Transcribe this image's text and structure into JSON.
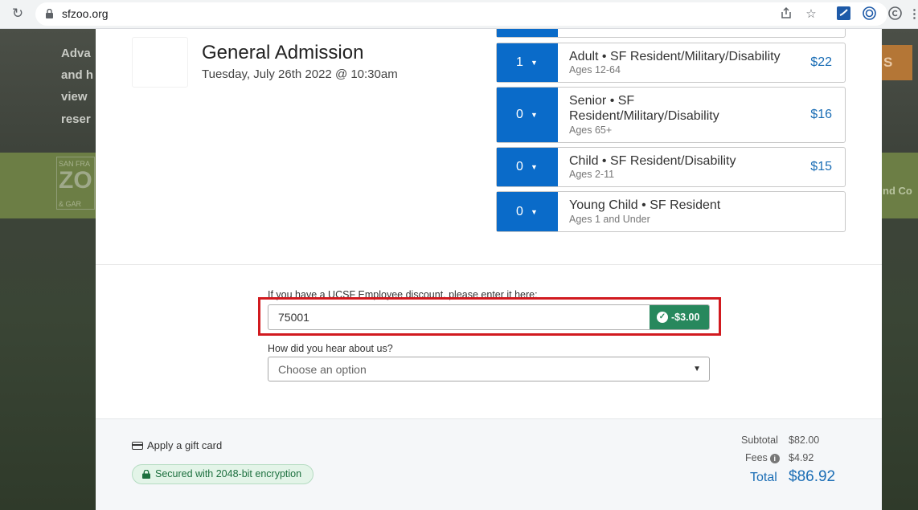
{
  "browser": {
    "url": "sfzoo.org"
  },
  "background": {
    "lines": [
      "Adva",
      "and h",
      "view",
      "reser"
    ],
    "side_text": "nd Co",
    "orange_text": "S",
    "logo_top": "SAN FRA",
    "logo_big": "ZO",
    "logo_bottom": "& GAR"
  },
  "event": {
    "title": "General Admission",
    "date": "Tuesday, July 26th 2022 @ 10:30am"
  },
  "tickets": [
    {
      "qty": "1",
      "name": "Adult • SF Resident/Military/Disability",
      "ages": "Ages 12-64",
      "price": "$22"
    },
    {
      "qty": "0",
      "name": "Senior • SF Resident/Military/Disability",
      "ages": "Ages 65+",
      "price": "$16"
    },
    {
      "qty": "0",
      "name": "Child • SF Resident/Disability",
      "ages": "Ages 2-11",
      "price": "$15"
    },
    {
      "qty": "0",
      "name": "Young Child • SF Resident",
      "ages": "Ages 1 and Under",
      "price": ""
    }
  ],
  "discount": {
    "label": "If you have a UCSF Employee discount, please enter it here:",
    "value": "75001",
    "applied": "-$3.00"
  },
  "hear": {
    "label": "How did you hear about us?",
    "placeholder": "Choose an option"
  },
  "footer": {
    "gift_card": "Apply a gift card",
    "secure": "Secured with 2048-bit encryption",
    "subtotal_label": "Subtotal",
    "subtotal": "$82.00",
    "fees_label": "Fees",
    "fees": "$4.92",
    "total_label": "Total",
    "total": "$86.92"
  },
  "colors": {
    "accent": "#0a6bc9",
    "success": "#27885d",
    "highlight": "#d11a1f"
  }
}
